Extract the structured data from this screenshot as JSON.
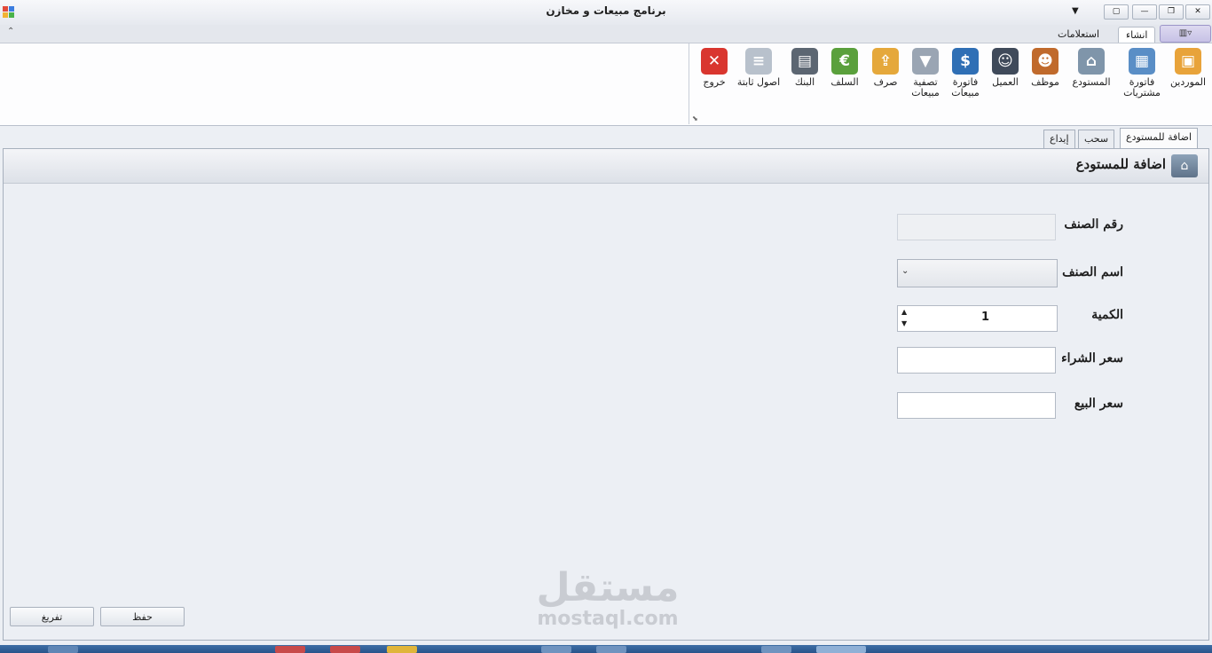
{
  "window": {
    "title": "برنامج مبيعات و مخازن",
    "quick_access_arrow": "▼",
    "buttons": {
      "minimize": "—",
      "restore": "❐",
      "close": "✕"
    }
  },
  "ribbon": {
    "tabs": [
      {
        "label": "انشاء",
        "active": true
      },
      {
        "label": "استعلامات",
        "active": false
      }
    ],
    "app_menu_label": "▥▿",
    "collapse_glyph": "⌃",
    "buttons": [
      {
        "label": "الموردين",
        "icon": "box-icon",
        "color": "#e8a33a",
        "glyph": "▣"
      },
      {
        "label": "فاتورة مشتريات",
        "icon": "calculator-icon",
        "color": "#5a8ec6",
        "glyph": "▦"
      },
      {
        "label": "المستودع",
        "icon": "warehouse-icon",
        "color": "#7f95aa",
        "glyph": "⌂"
      },
      {
        "label": "موظف",
        "icon": "employee-icon",
        "color": "#c06a2c",
        "glyph": "☻"
      },
      {
        "label": "العميل",
        "icon": "customer-icon",
        "color": "#3f4a5a",
        "glyph": "☺"
      },
      {
        "label": "فاتورة مبيعات",
        "icon": "price-tag-icon",
        "color": "#2f6fb5",
        "glyph": "$"
      },
      {
        "label": "تصفية مبيعات",
        "icon": "filter-icon",
        "color": "#9aa5b3",
        "glyph": "▼"
      },
      {
        "label": "صرف",
        "icon": "outbox-icon",
        "color": "#e5a83b",
        "glyph": "⇪"
      },
      {
        "label": "السلف",
        "icon": "coins-icon",
        "color": "#5aa03c",
        "glyph": "€"
      },
      {
        "label": "البنك",
        "icon": "safe-icon",
        "color": "#5c6672",
        "glyph": "▤"
      },
      {
        "label": "اصول ثابتة",
        "icon": "document-icon",
        "color": "#b8c1cc",
        "glyph": "≡"
      },
      {
        "label": "خروج",
        "icon": "exit-icon",
        "color": "#d9362f",
        "glyph": "✕"
      }
    ],
    "launcher_glyph": "⬊"
  },
  "doc_tabs": [
    {
      "label": "اضافة للمستودع",
      "active": true
    },
    {
      "label": "سحب",
      "active": false
    },
    {
      "label": "إيداع",
      "active": false
    }
  ],
  "form": {
    "title": "اضافة للمستودع",
    "fields": {
      "item_number": {
        "label": "رقم الصنف",
        "value": ""
      },
      "item_name": {
        "label": "اسم الصنف",
        "value": "",
        "arrow": "⌄"
      },
      "quantity": {
        "label": "الكمية",
        "value": "1",
        "up": "▲",
        "down": "▼"
      },
      "purchase_price": {
        "label": "سعر الشراء",
        "value": ""
      },
      "sale_price": {
        "label": "سعر البيع",
        "value": ""
      }
    },
    "save_label": "حفظ",
    "clear_label": "تفريغ"
  },
  "watermark": {
    "arabic": "مستقل",
    "latin": "mostaql.com"
  }
}
